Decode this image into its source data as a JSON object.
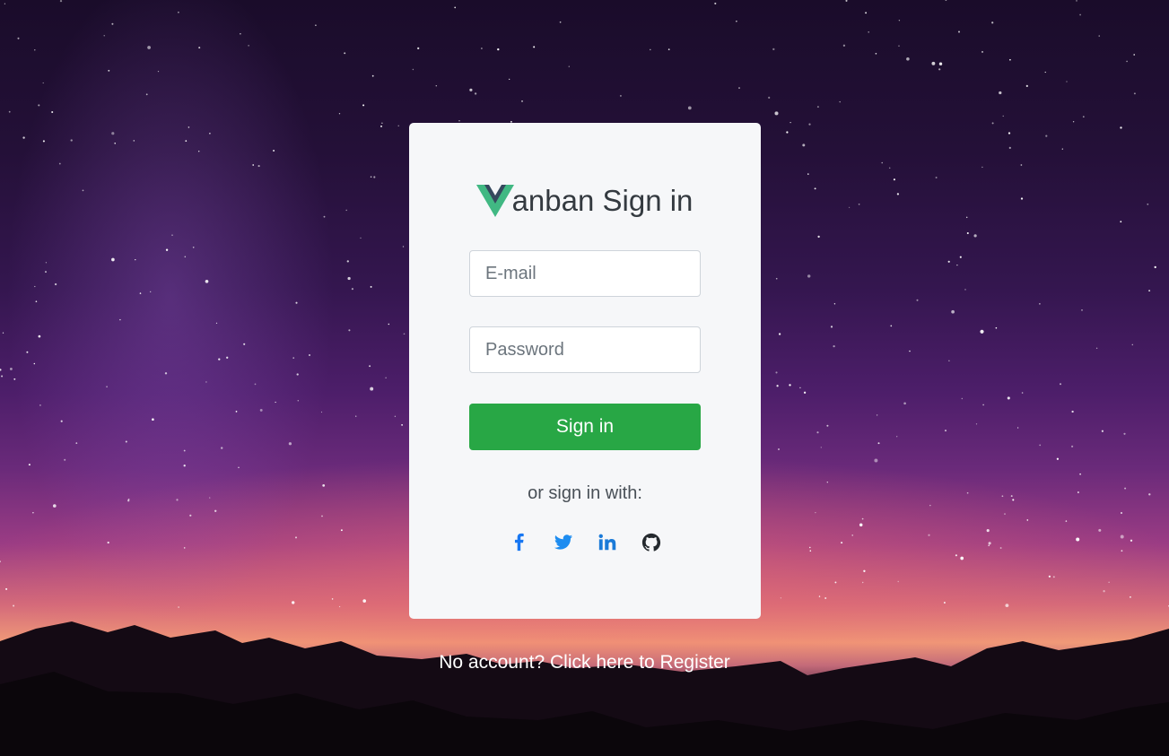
{
  "brand": {
    "logo_icon": "vue-v-logo-icon",
    "title": "anban Sign in",
    "logo_colors": {
      "outer": "#41b883",
      "inner": "#35495e"
    }
  },
  "form": {
    "email_placeholder": "E-mail",
    "password_placeholder": "Password",
    "submit_label": "Sign in"
  },
  "social": {
    "prompt": "or sign in with:",
    "providers": [
      {
        "name": "facebook",
        "icon": "facebook-icon",
        "color": "#1877f2"
      },
      {
        "name": "twitter",
        "icon": "twitter-icon",
        "color": "#1d8cf0"
      },
      {
        "name": "linkedin",
        "icon": "linkedin-icon",
        "color": "#1a7ad8"
      },
      {
        "name": "github",
        "icon": "github-icon",
        "color": "#24292e"
      }
    ]
  },
  "footer": {
    "register_text": "No account? Click here to Register"
  },
  "colors": {
    "card_bg": "#f6f7f9",
    "primary_button": "#28a745"
  }
}
